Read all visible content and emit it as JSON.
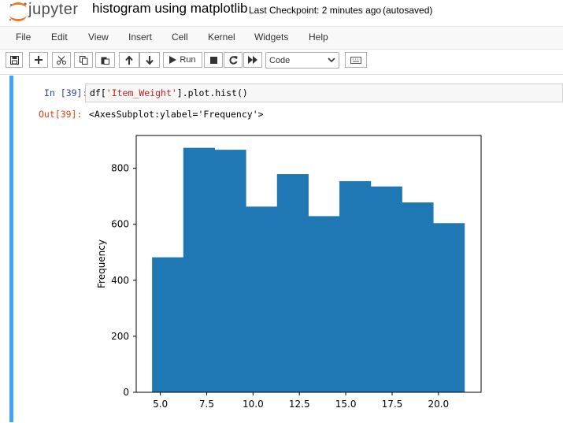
{
  "header": {
    "brand": "jupyter",
    "notebook_title": "histogram using matplotlib",
    "checkpoint": "Last Checkpoint: 2 minutes ago",
    "autosave": "(autosaved)"
  },
  "menu": [
    "File",
    "Edit",
    "View",
    "Insert",
    "Cell",
    "Kernel",
    "Widgets",
    "Help"
  ],
  "toolbar": {
    "run_label": "Run",
    "cell_type": "Code",
    "icons": [
      "save-icon",
      "plus-icon",
      "scissors-icon",
      "copy-icon",
      "paste-icon",
      "arrow-up-icon",
      "arrow-down-icon",
      "play-icon",
      "stop-icon",
      "restart-icon",
      "fast-forward-icon",
      "keyboard-icon"
    ]
  },
  "cell": {
    "in_prompt": "In [39]:",
    "code_prefix": "df[",
    "code_string": "'Item_Weight'",
    "code_suffix": "].plot.hist()",
    "out_prompt": "Out[39]:",
    "output_text": "<AxesSubplot:ylabel='Frequency'>"
  },
  "chart_data": {
    "type": "bar",
    "histogram": true,
    "bin_edges": [
      4.555,
      6.239,
      7.923,
      9.607,
      11.291,
      12.975,
      14.659,
      16.343,
      18.027,
      19.711,
      21.395
    ],
    "values": [
      482,
      873,
      866,
      663,
      779,
      629,
      754,
      735,
      678,
      604
    ],
    "ylabel": "Frequency",
    "xlim": [
      3.7,
      22.3
    ],
    "ylim": [
      0,
      917
    ],
    "x_ticks": [
      5.0,
      7.5,
      10.0,
      12.5,
      15.0,
      17.5,
      20.0
    ],
    "x_tick_labels": [
      "5.0",
      "7.5",
      "10.0",
      "12.5",
      "15.0",
      "17.5",
      "20.0"
    ],
    "y_ticks": [
      0,
      200,
      400,
      600,
      800
    ],
    "y_tick_labels": [
      "0",
      "200",
      "400",
      "600",
      "800"
    ],
    "bar_color": "#1f77b4",
    "grid": false
  }
}
